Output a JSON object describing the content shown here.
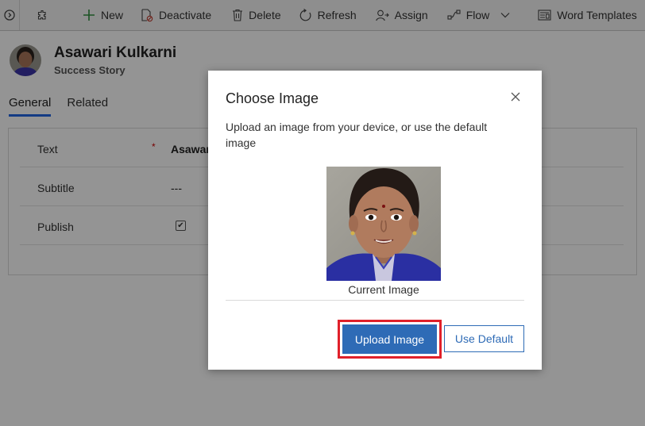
{
  "toolbar": {
    "nav_icon": "chevron-right-circle-icon",
    "items": [
      {
        "icon": "puzzle-icon",
        "label": ""
      },
      {
        "icon": "plus-icon",
        "label": "New"
      },
      {
        "icon": "deactivate-icon",
        "label": "Deactivate"
      },
      {
        "icon": "trash-icon",
        "label": "Delete"
      },
      {
        "icon": "refresh-icon",
        "label": "Refresh"
      },
      {
        "icon": "assign-icon",
        "label": "Assign"
      },
      {
        "icon": "flow-icon",
        "label": "Flow"
      },
      {
        "icon": "word-templates-icon",
        "label": "Word Templates"
      }
    ]
  },
  "record": {
    "name": "Asawari Kulkarni",
    "entity": "Success Story"
  },
  "tabs": [
    {
      "label": "General",
      "active": true
    },
    {
      "label": "Related",
      "active": false
    }
  ],
  "form": {
    "rows": [
      {
        "label": "Text",
        "required": "*",
        "value": "Asawari"
      },
      {
        "label": "Subtitle",
        "value": "---"
      },
      {
        "label": "Publish",
        "checked": true
      }
    ]
  },
  "dialog": {
    "title": "Choose Image",
    "description": "Upload an image from your device, or use the default image",
    "caption": "Current Image",
    "upload_label": "Upload Image",
    "default_label": "Use Default"
  },
  "colors": {
    "primary": "#2e6bb6",
    "highlight": "#e0202a",
    "tab_underline": "#2266e3"
  }
}
